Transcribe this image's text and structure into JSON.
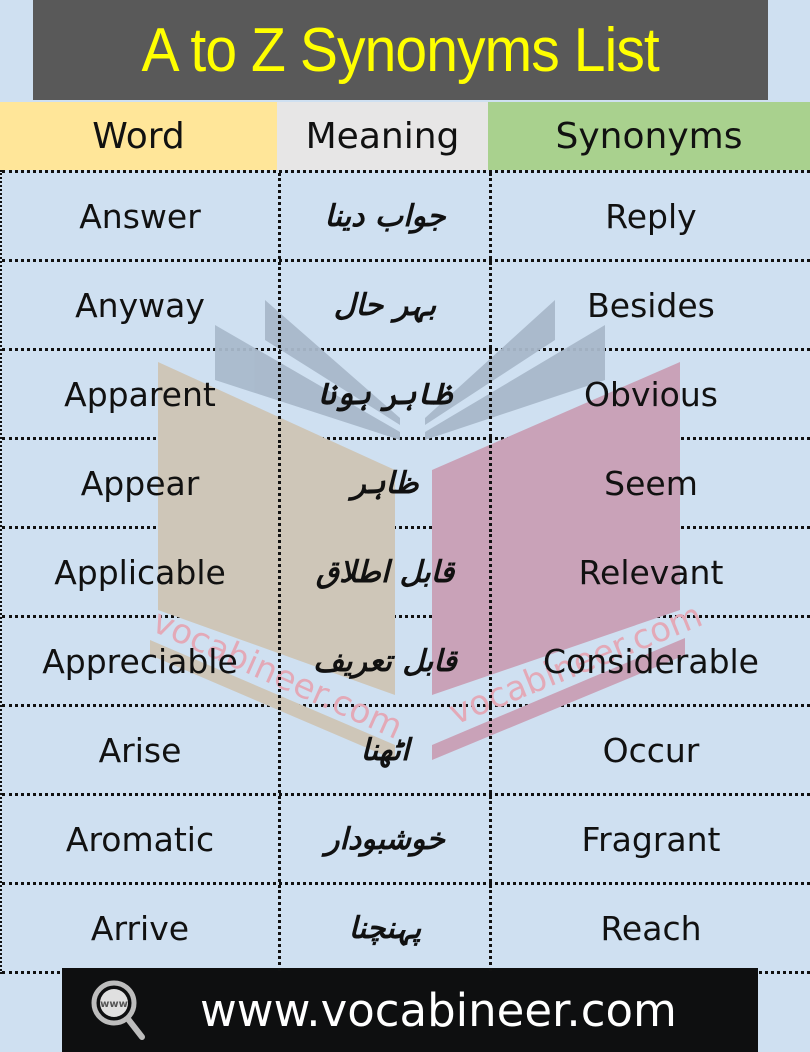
{
  "title": "A to Z Synonyms List",
  "columns": {
    "word": "Word",
    "meaning": "Meaning",
    "synonyms": "Synonyms"
  },
  "rows": [
    {
      "word": "Answer",
      "meaning": "جواب دینا",
      "synonym": "Reply"
    },
    {
      "word": "Anyway",
      "meaning": "بہر حال",
      "synonym": "Besides"
    },
    {
      "word": "Apparent",
      "meaning": "ظاہر ہونا",
      "synonym": "Obvious"
    },
    {
      "word": "Appear",
      "meaning": "ظاہر",
      "synonym": "Seem"
    },
    {
      "word": "Applicable",
      "meaning": "قابل اطلاق",
      "synonym": "Relevant"
    },
    {
      "word": "Appreciable",
      "meaning": "قابل تعریف",
      "synonym": "Considerable"
    },
    {
      "word": "Arise",
      "meaning": "اٹھنا",
      "synonym": "Occur"
    },
    {
      "word": "Aromatic",
      "meaning": "خوشبودار",
      "synonym": "Fragrant"
    },
    {
      "word": "Arrive",
      "meaning": "پہنچنا",
      "synonym": "Reach"
    }
  ],
  "watermark": {
    "left_text": "vocabineer.com",
    "right_text": "vocabineer.com",
    "icon": "open-book-logo"
  },
  "footer": {
    "icon": "www-magnifier-icon",
    "icon_text": "www",
    "url": "www.vocabineer.com"
  },
  "colors": {
    "title_bg": "#595959",
    "title_text": "#ffff00",
    "word_header": "#ffe699",
    "meaning_header": "#e7e6e6",
    "synonyms_header": "#a9d18e",
    "table_bg": "#cfe0f1",
    "footer_bg": "#0e0f10"
  }
}
